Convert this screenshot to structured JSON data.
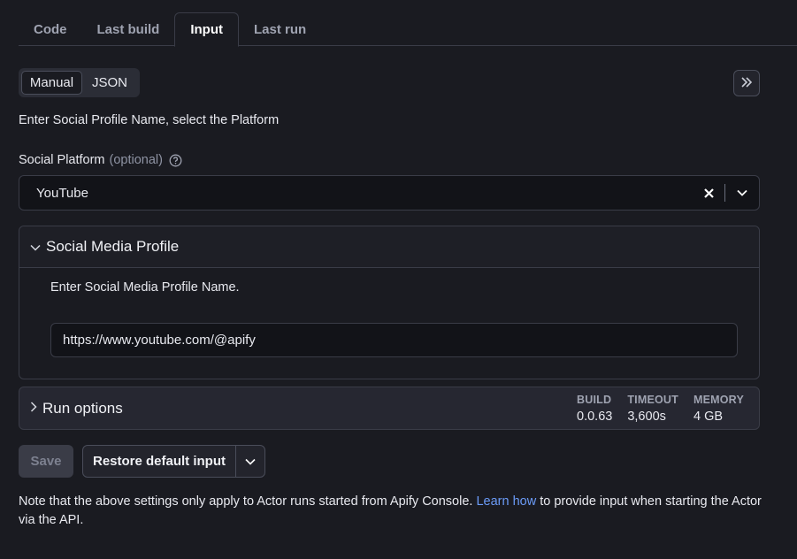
{
  "tabs": [
    {
      "label": "Code",
      "active": false
    },
    {
      "label": "Last build",
      "active": false
    },
    {
      "label": "Input",
      "active": true
    },
    {
      "label": "Last run",
      "active": false
    }
  ],
  "mode_toggle": {
    "manual": "Manual",
    "json": "JSON",
    "selected": "Manual"
  },
  "description": "Enter Social Profile Name, select the Platform",
  "platform_field": {
    "label": "Social Platform",
    "optional": "(optional)",
    "value": "YouTube"
  },
  "profile_section": {
    "title": "Social Media Profile",
    "description": "Enter Social Media Profile Name.",
    "input_value": "https://www.youtube.com/@apify"
  },
  "run_options": {
    "title": "Run options",
    "stats": [
      {
        "label": "BUILD",
        "value": "0.0.63"
      },
      {
        "label": "TIMEOUT",
        "value": "3,600s"
      },
      {
        "label": "MEMORY",
        "value": "4 GB"
      }
    ]
  },
  "actions": {
    "save": "Save",
    "restore": "Restore default input"
  },
  "note": {
    "before": "Note that the above settings only apply to Actor runs started from Apify Console. ",
    "link": "Learn how",
    "after": " to provide input when starting the Actor via the API."
  },
  "colors": {
    "background": "#1a1b21",
    "link": "#6b9bf7",
    "border": "#3a3c47"
  }
}
